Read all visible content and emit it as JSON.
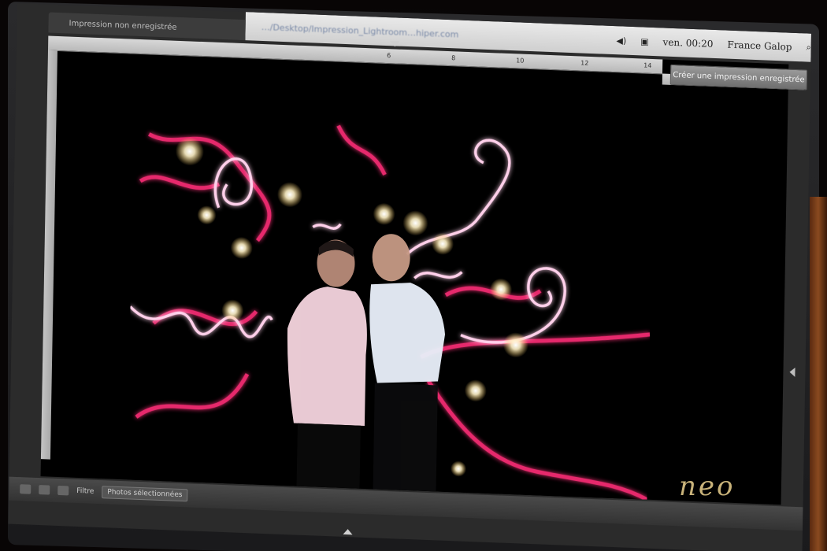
{
  "os_menubar": {
    "blurred_url": "…/Desktop/Impression_Lightroom…hiper.com",
    "clock": "ven. 00:20",
    "user": "France Galop"
  },
  "lightroom": {
    "panel_title": "Impression non enregistrée",
    "save_button_label": "Créer une impression enregistrée",
    "ruler_ticks": [
      "6",
      "8",
      "10",
      "12",
      "14"
    ],
    "filmstrip_label": "Filtre",
    "filmstrip_selection": "Photos sélectionnées"
  },
  "photo": {
    "description_alt": "light painting portrait"
  },
  "watermark": "neo",
  "colors": {
    "light_trail": "#ff2d78",
    "light_trail_bright": "#ffd0ea",
    "star": "#fff6d8",
    "shirt_left": "#f2d2dc",
    "shirt_right": "#e8eef8"
  }
}
